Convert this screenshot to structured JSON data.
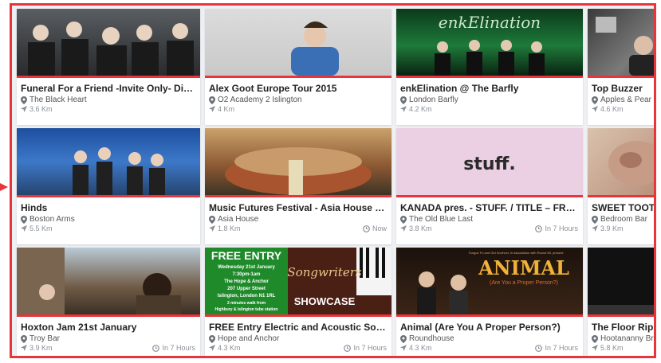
{
  "cards": [
    {
      "title": "Funeral For a Friend -Invite Only- Distill...",
      "venue": "The Black Heart",
      "distance": "3.6 Km",
      "time": ""
    },
    {
      "title": "Alex Goot Europe Tour 2015",
      "venue": "O2 Academy 2 Islington",
      "distance": "4 Km",
      "time": ""
    },
    {
      "title": "enkElination @ The Barfly",
      "venue": "London Barfly",
      "distance": "4.2 Km",
      "time": "",
      "image_text": "enkElination"
    },
    {
      "title": "Top Buzzer",
      "venue": "Apples & Pear",
      "distance": "4.6 Km",
      "time": ""
    },
    {
      "title": "Hinds",
      "venue": "Boston Arms",
      "distance": "5.5 Km",
      "time": ""
    },
    {
      "title": "Music Futures Festival - Asia House Lon...",
      "venue": "Asia House",
      "distance": "1.8 Km",
      "time": "Now"
    },
    {
      "title": "KANADA pres. - STUFF. / TITLE – FREE EN...",
      "venue": "The Old Blue Last",
      "distance": "3.8 Km",
      "time": "In 7 Hours",
      "image_text": "stuff."
    },
    {
      "title": "SWEET TOOTH -",
      "venue": "Bedroom Bar",
      "distance": "3.9 Km",
      "time": ""
    },
    {
      "title": "Hoxton Jam 21st January",
      "venue": "Troy Bar",
      "distance": "3.9 Km",
      "time": "In 7 Hours"
    },
    {
      "title": "FREE Entry Electric and Acoustic Songwri...",
      "venue": "Hope and Anchor",
      "distance": "4.3 Km",
      "time": "In 7 Hours",
      "image_text": {
        "headline": "FREE ENTRY",
        "lines": [
          "Wednesday 21st January",
          "7:30pm-1am",
          "The Hope & Anchor",
          "207 Upper Street",
          "Islington, London N1 1RL",
          "2 minutes walk from",
          "Highbury & Islington tube station"
        ],
        "script": "Songwriters",
        "showcase": "SHOWCASE"
      }
    },
    {
      "title": "Animal (Are You A Proper Person?)",
      "venue": "Roundhouse",
      "distance": "4.3 Km",
      "time": "In 7 Hours",
      "image_text": {
        "headline": "ANIMAL",
        "sub": "(Are You a Proper Person?)",
        "top": "Tongue Fu and Get Involved, in association with Round 60, present"
      }
    },
    {
      "title": "The Floor Rippe",
      "venue": "Hootananny Br",
      "distance": "5.8 Km",
      "time": ""
    }
  ],
  "colors": {
    "accent": "#e8343a",
    "time_gray": "#8a8f96"
  },
  "icons": {
    "venue": "map-pin-icon",
    "distance": "navigation-arrow-icon",
    "time": "clock-icon"
  }
}
